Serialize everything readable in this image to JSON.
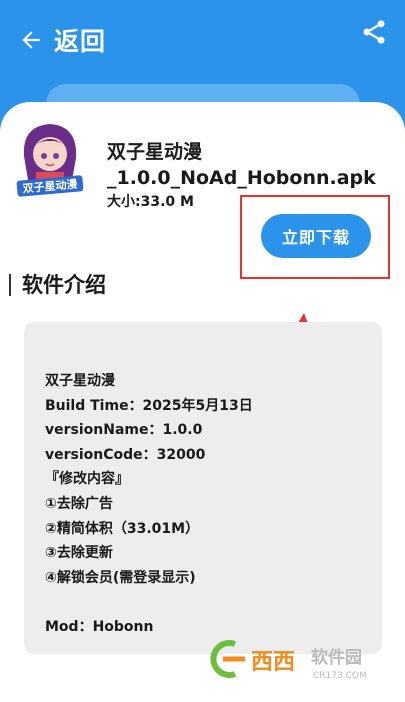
{
  "header": {
    "back_label": "返回",
    "back_icon": "arrow-left-icon",
    "share_icon": "share-icon"
  },
  "app": {
    "name_line1": "双子星动漫",
    "name_line2": "_1.0.0_NoAd_Hobonn.apk",
    "size": "大小:33.0 M",
    "icon": "app-logo-icon",
    "icon_caption": "双子星动漫"
  },
  "download": {
    "label": "立即下载"
  },
  "intro": {
    "title": "软件介绍",
    "lines": [
      "双子星动漫",
      "Build Time：2025年5月13日",
      "versionName：1.0.0",
      "versionCode：32000",
      "『修改内容』",
      "①去除广告",
      "②精简体积（33.01M）",
      "③去除更新",
      "④解锁会员(需登录显示)",
      "",
      "Mod：Hobonn"
    ]
  },
  "watermark": {
    "brand": "西西",
    "site_name": "软件园",
    "site_url": "CR173.COM"
  },
  "colors": {
    "primary": "#2b93ea",
    "highlight": "#e8322e",
    "desc_bg": "#ededed"
  }
}
